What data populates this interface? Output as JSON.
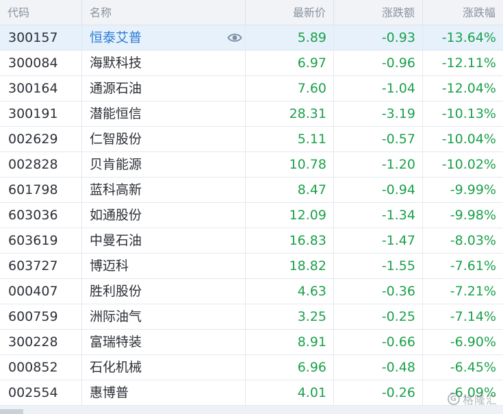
{
  "columns": {
    "code": "代码",
    "name": "名称",
    "price": "最新价",
    "change": "涨跌额",
    "pct": "涨跌幅"
  },
  "rows": [
    {
      "code": "300157",
      "name": "恒泰艾普",
      "price": "5.89",
      "change": "-0.93",
      "pct": "-13.64%",
      "selected": true
    },
    {
      "code": "300084",
      "name": "海默科技",
      "price": "6.97",
      "change": "-0.96",
      "pct": "-12.11%"
    },
    {
      "code": "300164",
      "name": "通源石油",
      "price": "7.60",
      "change": "-1.04",
      "pct": "-12.04%"
    },
    {
      "code": "300191",
      "name": "潜能恒信",
      "price": "28.31",
      "change": "-3.19",
      "pct": "-10.13%"
    },
    {
      "code": "002629",
      "name": "仁智股份",
      "price": "5.11",
      "change": "-0.57",
      "pct": "-10.04%"
    },
    {
      "code": "002828",
      "name": "贝肯能源",
      "price": "10.78",
      "change": "-1.20",
      "pct": "-10.02%"
    },
    {
      "code": "601798",
      "name": "蓝科高新",
      "price": "8.47",
      "change": "-0.94",
      "pct": "-9.99%"
    },
    {
      "code": "603036",
      "name": "如通股份",
      "price": "12.09",
      "change": "-1.34",
      "pct": "-9.98%"
    },
    {
      "code": "603619",
      "name": "中曼石油",
      "price": "16.83",
      "change": "-1.47",
      "pct": "-8.03%"
    },
    {
      "code": "603727",
      "name": "博迈科",
      "price": "18.82",
      "change": "-1.55",
      "pct": "-7.61%"
    },
    {
      "code": "000407",
      "name": "胜利股份",
      "price": "4.63",
      "change": "-0.36",
      "pct": "-7.21%"
    },
    {
      "code": "600759",
      "name": "洲际油气",
      "price": "3.25",
      "change": "-0.25",
      "pct": "-7.14%"
    },
    {
      "code": "300228",
      "name": "富瑞特装",
      "price": "8.91",
      "change": "-0.66",
      "pct": "-6.90%"
    },
    {
      "code": "000852",
      "name": "石化机械",
      "price": "6.96",
      "change": "-0.48",
      "pct": "-6.45%"
    },
    {
      "code": "002554",
      "name": "惠博普",
      "price": "4.01",
      "change": "-0.26",
      "pct": "-6.09%"
    }
  ],
  "icons": {
    "watch": "eye-icon",
    "watermark_logo": "gelonghui-logo"
  },
  "watermark": {
    "text": "格隆汇"
  },
  "colors": {
    "down": "#1aa04a",
    "selected_bg": "#e6f1fc",
    "selected_name": "#2a7bd4",
    "header_bg": "#f1f3f6"
  }
}
